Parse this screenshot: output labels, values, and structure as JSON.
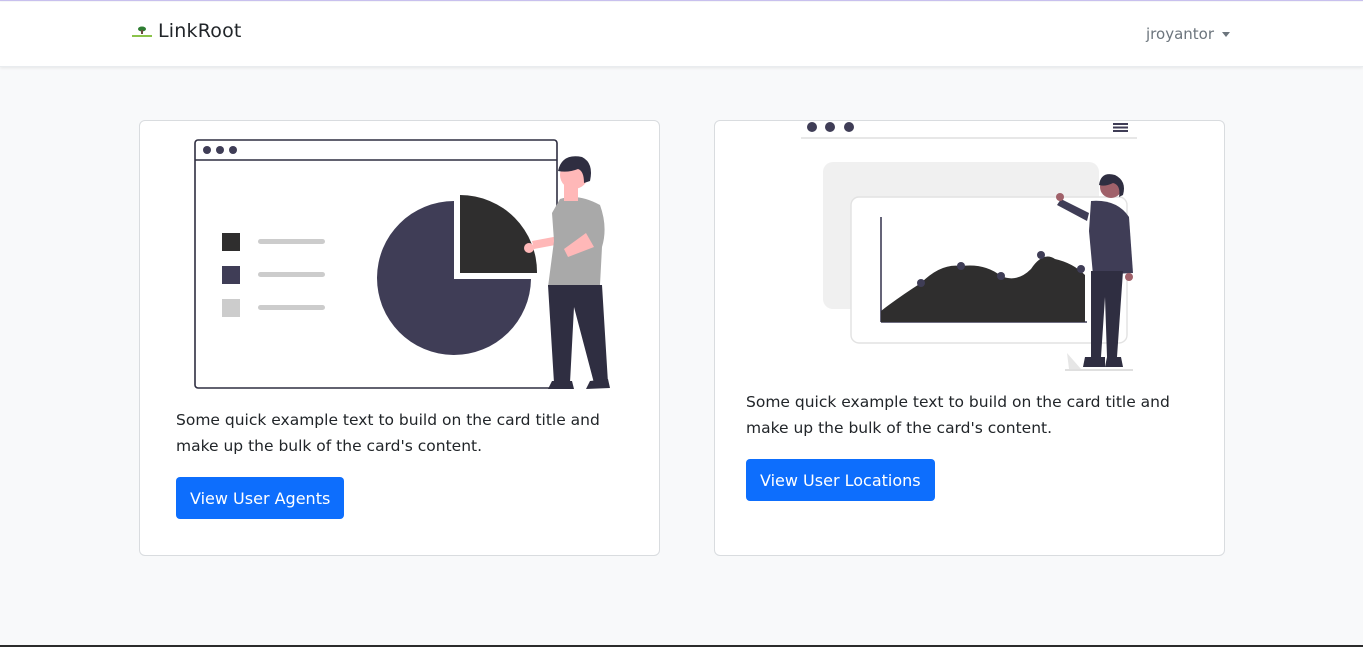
{
  "navbar": {
    "brand": "LinkRoot",
    "user": "jroyantor"
  },
  "cards": [
    {
      "text": "Some quick example text to build on the card title and make up the bulk of the card's content.",
      "button": "View User Agents"
    },
    {
      "text": "Some quick example text to build on the card title and make up the bulk of the card's content.",
      "button": "View User Locations"
    }
  ],
  "colors": {
    "primary": "#0d6efd",
    "illustration_dark": "#3f3d56",
    "illustration_black": "#2f2e2e",
    "skin": "#ffb8b8",
    "shirt_gray": "#a9a9a9"
  }
}
